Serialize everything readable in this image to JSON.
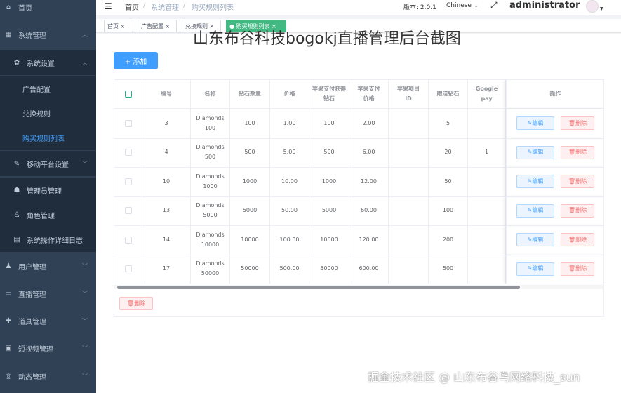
{
  "sidebar": {
    "items": [
      {
        "label": "首页",
        "icon": "home-icon"
      },
      {
        "label": "系统管理",
        "icon": "grid-icon"
      },
      {
        "label": "系统设置",
        "icon": "gear-icon"
      },
      {
        "label": "广告配置"
      },
      {
        "label": "兑换规则"
      },
      {
        "label": "购买规则列表"
      },
      {
        "label": "移动平台设置",
        "icon": "wrench-icon"
      },
      {
        "label": "管理员管理",
        "icon": "users-icon"
      },
      {
        "label": "角色管理",
        "icon": "user-icon"
      },
      {
        "label": "系统操作详细日志",
        "icon": "log-icon"
      },
      {
        "label": "用户管理",
        "icon": "user-icon"
      },
      {
        "label": "直播管理",
        "icon": "video-icon"
      },
      {
        "label": "道具管理",
        "icon": "gift-icon"
      },
      {
        "label": "短视频管理",
        "icon": "film-icon"
      },
      {
        "label": "动态管理",
        "icon": "pulse-icon"
      }
    ]
  },
  "topbar": {
    "breadcrumb": [
      "首页",
      "系统管理",
      "购买规则列表"
    ],
    "version": "版本: 2.0.1",
    "language": "Chinese",
    "username": "administrator"
  },
  "tags": [
    {
      "label": "首页 ×"
    },
    {
      "label": "广告配置 ×"
    },
    {
      "label": "兑换规则 ×"
    },
    {
      "label": "● 购买规则列表 ×"
    }
  ],
  "overlay_title": "山东布谷科技bogokj直播管理后台截图",
  "add_button": "+ 添加",
  "table": {
    "headers": [
      "编号",
      "名称",
      "钻石数量",
      "价格",
      "苹果支付获得钻石",
      "苹果支付价格",
      "苹果项目ID",
      "赠送钻石",
      "Google pay",
      "操作"
    ],
    "rows": [
      {
        "id": "3",
        "name": "Diamonds 100",
        "count": "100",
        "price": "1.00",
        "apple_diamonds": "100",
        "apple_price": "2.00",
        "apple_id": "",
        "gift": "5",
        "google": ""
      },
      {
        "id": "4",
        "name": "Diamonds 500",
        "count": "500",
        "price": "5.00",
        "apple_diamonds": "500",
        "apple_price": "6.00",
        "apple_id": "",
        "gift": "20",
        "google": "1"
      },
      {
        "id": "10",
        "name": "Diamonds 1000",
        "count": "1000",
        "price": "10.00",
        "apple_diamonds": "1000",
        "apple_price": "12.00",
        "apple_id": "",
        "gift": "50",
        "google": ""
      },
      {
        "id": "13",
        "name": "Diamonds 5000",
        "count": "5000",
        "price": "50.00",
        "apple_diamonds": "5000",
        "apple_price": "60.00",
        "apple_id": "",
        "gift": "100",
        "google": ""
      },
      {
        "id": "14",
        "name": "Diamonds 10000",
        "count": "10000",
        "price": "100.00",
        "apple_diamonds": "10000",
        "apple_price": "120.00",
        "apple_id": "",
        "gift": "200",
        "google": ""
      },
      {
        "id": "17",
        "name": "Diamonds 50000",
        "count": "50000",
        "price": "500.00",
        "apple_diamonds": "50000",
        "apple_price": "600.00",
        "apple_id": "",
        "gift": "500",
        "google": ""
      }
    ],
    "edit_label": "编辑",
    "delete_label": "删除"
  },
  "bulk_delete": "删除",
  "footer_watermark": "掘金技术社区 @ 山东布谷鸟网络科技_sun",
  "colors": {
    "sidebar_bg": "#304156",
    "accent": "#409eff",
    "active_tag": "#42b983",
    "danger": "#f56c6c"
  }
}
